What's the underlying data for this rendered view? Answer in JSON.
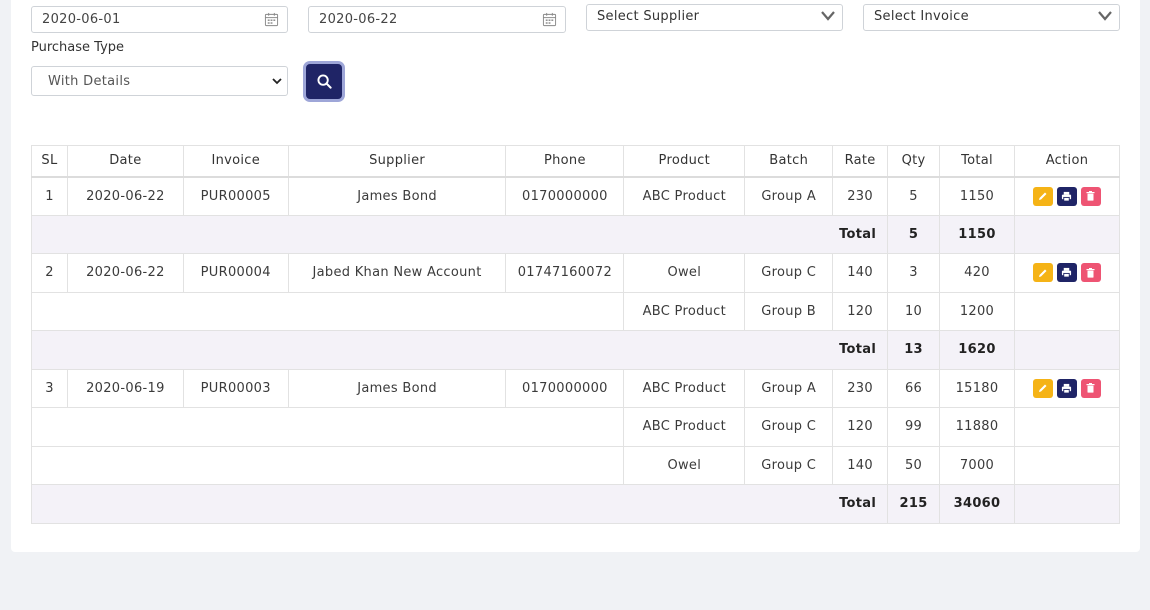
{
  "filters": {
    "date_from": "2020-06-01",
    "date_to": "2020-06-22",
    "supplier_placeholder": "Select Supplier",
    "invoice_placeholder": "Select Invoice",
    "purchase_type_label": "Purchase Type",
    "purchase_type_value": "With Details"
  },
  "table": {
    "headers": [
      "SL",
      "Date",
      "Invoice",
      "Supplier",
      "Phone",
      "Product",
      "Batch",
      "Rate",
      "Qty",
      "Total",
      "Action"
    ],
    "total_label": "Total",
    "groups": [
      {
        "sl": "1",
        "date": "2020-06-22",
        "invoice": "PUR00005",
        "supplier": "James Bond",
        "phone": "0170000000",
        "items": [
          {
            "product": "ABC Product",
            "batch": "Group A",
            "rate": "230",
            "qty": "5",
            "total": "1150"
          }
        ],
        "total_qty": "5",
        "total_amount": "1150"
      },
      {
        "sl": "2",
        "date": "2020-06-22",
        "invoice": "PUR00004",
        "supplier": "Jabed Khan New Account",
        "phone": "01747160072",
        "items": [
          {
            "product": "Owel",
            "batch": "Group C",
            "rate": "140",
            "qty": "3",
            "total": "420"
          },
          {
            "product": "ABC Product",
            "batch": "Group B",
            "rate": "120",
            "qty": "10",
            "total": "1200"
          }
        ],
        "total_qty": "13",
        "total_amount": "1620"
      },
      {
        "sl": "3",
        "date": "2020-06-19",
        "invoice": "PUR00003",
        "supplier": "James Bond",
        "phone": "0170000000",
        "items": [
          {
            "product": "ABC Product",
            "batch": "Group A",
            "rate": "230",
            "qty": "66",
            "total": "15180"
          },
          {
            "product": "ABC Product",
            "batch": "Group C",
            "rate": "120",
            "qty": "99",
            "total": "11880"
          },
          {
            "product": "Owel",
            "batch": "Group C",
            "rate": "140",
            "qty": "50",
            "total": "7000"
          }
        ],
        "total_qty": "215",
        "total_amount": "34060"
      }
    ]
  },
  "icons": {
    "calendar": "calendar-icon",
    "chevron": "chevron-down-icon",
    "search": "search-icon",
    "edit": "pencil-icon",
    "print": "printer-icon",
    "delete": "trash-icon"
  },
  "colors": {
    "primary": "#1f2466",
    "edit": "#f5b316",
    "delete": "#ee5473",
    "total_row_bg": "#f4f2f8"
  }
}
